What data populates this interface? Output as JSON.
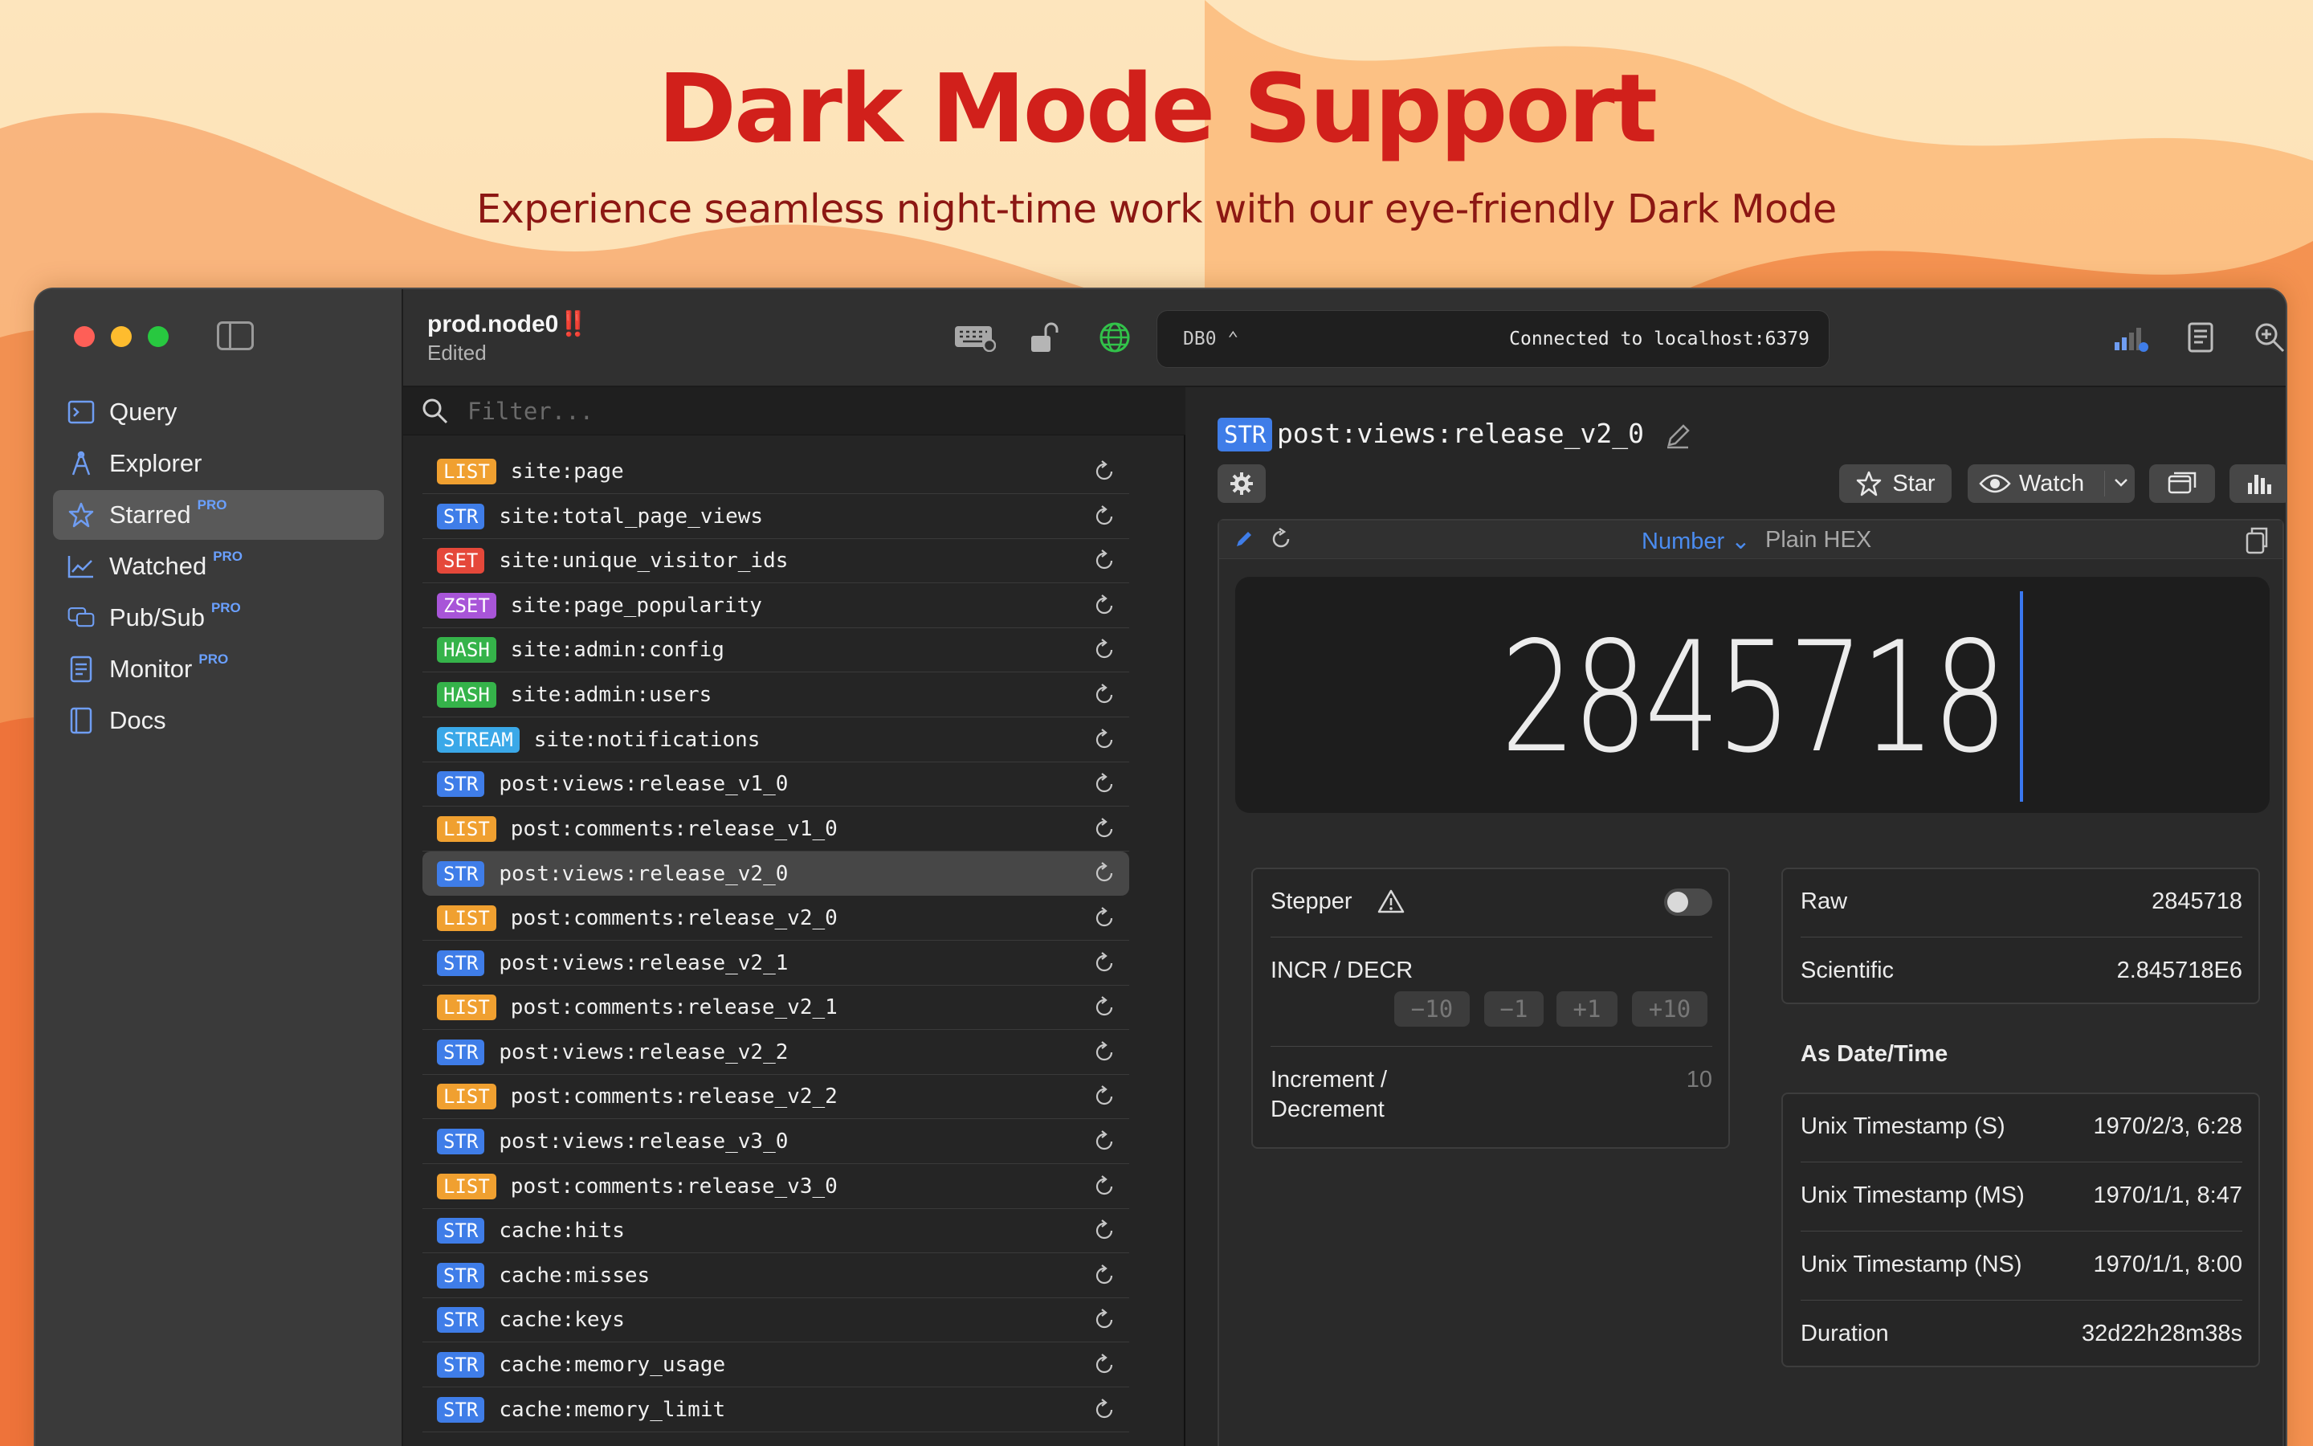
{
  "hero": {
    "title": "Dark Mode Support",
    "subtitle": "Experience seamless night-time work with our eye-friendly Dark Mode"
  },
  "sidebar": {
    "items": [
      {
        "label": "Query",
        "icon": "terminal-icon",
        "pro": ""
      },
      {
        "label": "Explorer",
        "icon": "compass-icon",
        "pro": ""
      },
      {
        "label": "Starred",
        "icon": "star-icon",
        "pro": "PRO"
      },
      {
        "label": "Watched",
        "icon": "chart-icon",
        "pro": "PRO"
      },
      {
        "label": "Pub/Sub",
        "icon": "chat-icon",
        "pro": "PRO"
      },
      {
        "label": "Monitor",
        "icon": "document-icon",
        "pro": "PRO"
      },
      {
        "label": "Docs",
        "icon": "book-icon",
        "pro": ""
      }
    ]
  },
  "toolbar": {
    "connection_name": "prod.node0",
    "connection_flag": "‼️",
    "connection_status": "Edited",
    "db_selector": "DB0 ⌃",
    "db_status": "Connected to localhost:6379"
  },
  "keylist": {
    "filter_placeholder": "Filter...",
    "keys": [
      {
        "type": "LIST",
        "name": "site:page"
      },
      {
        "type": "STR",
        "name": "site:total_page_views"
      },
      {
        "type": "SET",
        "name": "site:unique_visitor_ids"
      },
      {
        "type": "ZSET",
        "name": "site:page_popularity"
      },
      {
        "type": "HASH",
        "name": "site:admin:config"
      },
      {
        "type": "HASH",
        "name": "site:admin:users"
      },
      {
        "type": "STREAM",
        "name": "site:notifications"
      },
      {
        "type": "STR",
        "name": "post:views:release_v1_0"
      },
      {
        "type": "LIST",
        "name": "post:comments:release_v1_0"
      },
      {
        "type": "STR",
        "name": "post:views:release_v2_0"
      },
      {
        "type": "LIST",
        "name": "post:comments:release_v2_0"
      },
      {
        "type": "STR",
        "name": "post:views:release_v2_1"
      },
      {
        "type": "LIST",
        "name": "post:comments:release_v2_1"
      },
      {
        "type": "STR",
        "name": "post:views:release_v2_2"
      },
      {
        "type": "LIST",
        "name": "post:comments:release_v2_2"
      },
      {
        "type": "STR",
        "name": "post:views:release_v3_0"
      },
      {
        "type": "LIST",
        "name": "post:comments:release_v3_0"
      },
      {
        "type": "STR",
        "name": "cache:hits"
      },
      {
        "type": "STR",
        "name": "cache:misses"
      },
      {
        "type": "STR",
        "name": "cache:keys"
      },
      {
        "type": "STR",
        "name": "cache:memory_usage"
      },
      {
        "type": "STR",
        "name": "cache:memory_limit"
      }
    ],
    "type_colors": {
      "LIST": "#f0a030",
      "STR": "#3f7de8",
      "SET": "#e5483a",
      "ZSET": "#a855d8",
      "HASH": "#35b34a",
      "STREAM": "#3aa8e8"
    }
  },
  "detail": {
    "key_type": "STR",
    "key_name": "post:views:release_v2_0",
    "star_label": "Star",
    "watch_label": "Watch",
    "format_selected": "Number ⌄",
    "format_other": "Plain HEX",
    "value": "2845718",
    "stepper": {
      "label": "Stepper",
      "incr_label": "INCR / DECR",
      "buttons": [
        "−10",
        "−1",
        "+1",
        "+10"
      ],
      "increment_label": "Increment / Decrement",
      "increment_value": "10"
    },
    "representations": [
      {
        "label": "Raw",
        "value": "2845718"
      },
      {
        "label": "Scientific",
        "value": "2.845718E6"
      }
    ],
    "datetime_heading": "As Date/Time",
    "datetime": [
      {
        "label": "Unix Timestamp (S)",
        "value": "1970/2/3, 6:28"
      },
      {
        "label": "Unix Timestamp (MS)",
        "value": "1970/1/1, 8:47"
      },
      {
        "label": "Unix Timestamp (NS)",
        "value": "1970/1/1, 8:00"
      },
      {
        "label": "Duration",
        "value": "32d22h28m38s"
      }
    ]
  },
  "colors": {
    "accent": "#3f7de8",
    "hero_title": "#d1201b",
    "hero_subtitle": "#8c1713"
  }
}
